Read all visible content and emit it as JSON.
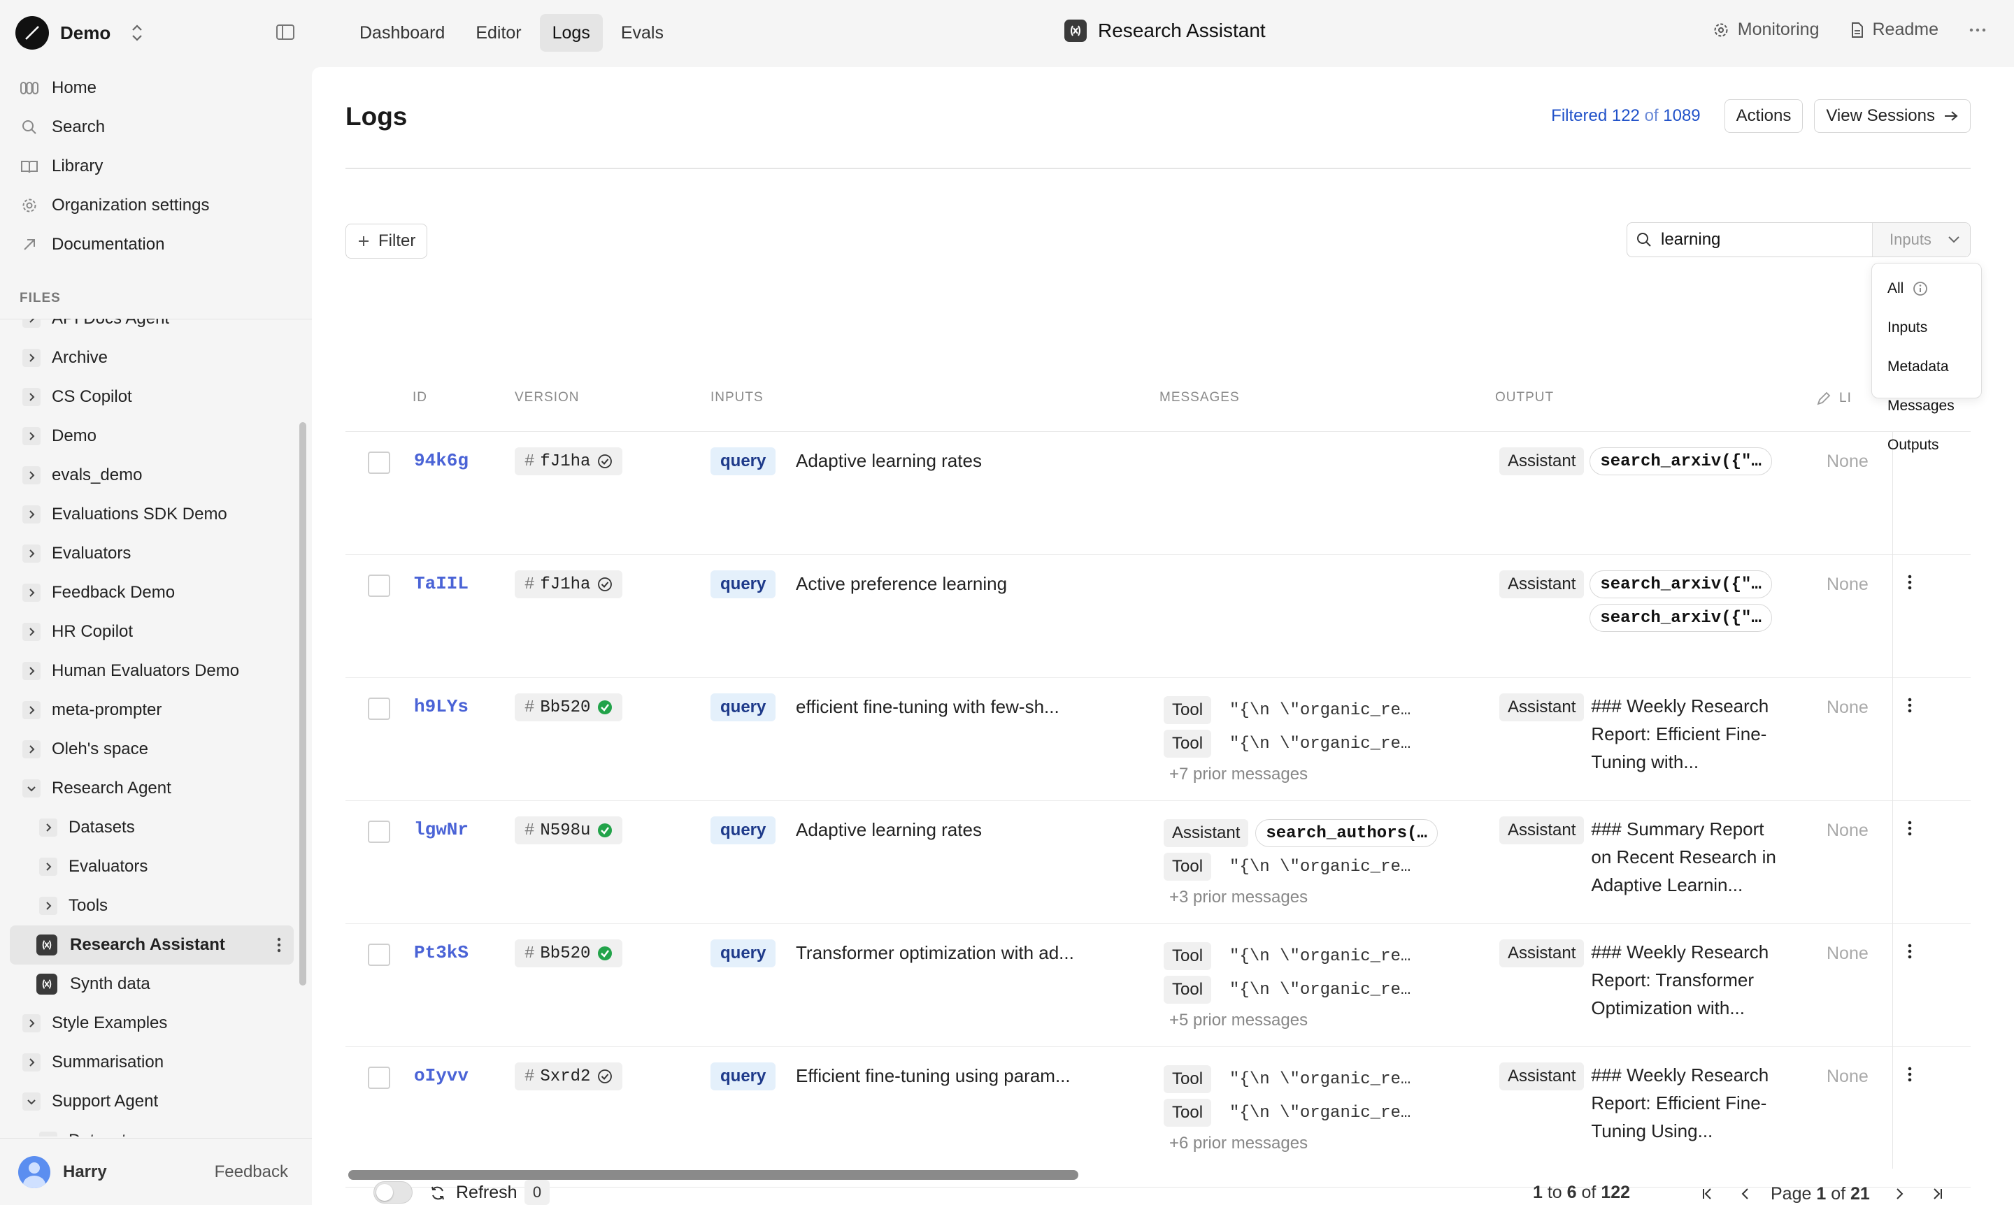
{
  "workspace": {
    "name": "Demo"
  },
  "nav": [
    {
      "label": "Home",
      "icon": "home-icon"
    },
    {
      "label": "Search",
      "icon": "search-icon"
    },
    {
      "label": "Library",
      "icon": "book-icon"
    },
    {
      "label": "Organization settings",
      "icon": "gear-icon"
    },
    {
      "label": "Documentation",
      "icon": "external-link-icon"
    }
  ],
  "files_label": "FILES",
  "tree": [
    {
      "label": "API Docs Agent",
      "type": "folder",
      "depth": 0,
      "expanded": false
    },
    {
      "label": "Archive",
      "type": "folder",
      "depth": 0,
      "expanded": false
    },
    {
      "label": "CS Copilot",
      "type": "folder",
      "depth": 0,
      "expanded": false
    },
    {
      "label": "Demo",
      "type": "folder",
      "depth": 0,
      "expanded": false
    },
    {
      "label": "evals_demo",
      "type": "folder",
      "depth": 0,
      "expanded": false
    },
    {
      "label": "Evaluations SDK Demo",
      "type": "folder",
      "depth": 0,
      "expanded": false
    },
    {
      "label": "Evaluators",
      "type": "folder",
      "depth": 0,
      "expanded": false
    },
    {
      "label": "Feedback Demo",
      "type": "folder",
      "depth": 0,
      "expanded": false
    },
    {
      "label": "HR Copilot",
      "type": "folder",
      "depth": 0,
      "expanded": false
    },
    {
      "label": "Human Evaluators Demo",
      "type": "folder",
      "depth": 0,
      "expanded": false
    },
    {
      "label": "meta-prompter",
      "type": "folder",
      "depth": 0,
      "expanded": false
    },
    {
      "label": "Oleh's space",
      "type": "folder",
      "depth": 0,
      "expanded": false
    },
    {
      "label": "Research Agent",
      "type": "folder",
      "depth": 0,
      "expanded": true
    },
    {
      "label": "Datasets",
      "type": "folder",
      "depth": 1,
      "expanded": false
    },
    {
      "label": "Evaluators",
      "type": "folder",
      "depth": 1,
      "expanded": false
    },
    {
      "label": "Tools",
      "type": "folder",
      "depth": 1,
      "expanded": false
    },
    {
      "label": "Research Assistant",
      "type": "prompt",
      "depth": 1,
      "active": true
    },
    {
      "label": "Synth data",
      "type": "prompt",
      "depth": 1
    },
    {
      "label": "Style Examples",
      "type": "folder",
      "depth": 0,
      "expanded": false
    },
    {
      "label": "Summarisation",
      "type": "folder",
      "depth": 0,
      "expanded": false
    },
    {
      "label": "Support Agent",
      "type": "folder",
      "depth": 0,
      "expanded": true
    },
    {
      "label": "Datasets",
      "type": "folder",
      "depth": 1,
      "expanded": false
    }
  ],
  "user": {
    "name": "Harry",
    "feedback": "Feedback"
  },
  "tabs": [
    {
      "label": "Dashboard",
      "active": false
    },
    {
      "label": "Editor",
      "active": false
    },
    {
      "label": "Logs",
      "active": true
    },
    {
      "label": "Evals",
      "active": false
    }
  ],
  "file_title": "Research Assistant",
  "top_right": {
    "monitoring": "Monitoring",
    "readme": "Readme"
  },
  "page": {
    "title": "Logs",
    "filtered_label": "Filtered",
    "filtered_count": "122",
    "of": "of",
    "total_count": "1089",
    "actions_label": "Actions",
    "view_sessions_label": "View Sessions",
    "filter_label": "Filter"
  },
  "search": {
    "value": "learning",
    "scope": "Inputs"
  },
  "scope_options": [
    "All",
    "Inputs",
    "Metadata",
    "Messages",
    "Outputs"
  ],
  "columns": {
    "id": "ID",
    "version": "VERSION",
    "inputs": "INPUTS",
    "messages": "MESSAGES",
    "output": "OUTPUT",
    "extra": "LI"
  },
  "rows": [
    {
      "id": "94k6g",
      "version": "fJ1ha",
      "deployed": false,
      "input_key": "query",
      "input_value": "Adaptive learning rates",
      "messages": [],
      "prior": "",
      "output_role": "Assistant",
      "output_calls": [
        "search_arxiv({\"…"
      ],
      "output_text": "",
      "extra": "None"
    },
    {
      "id": "TaIIL",
      "version": "fJ1ha",
      "deployed": false,
      "input_key": "query",
      "input_value": "Active preference learning",
      "messages": [],
      "prior": "",
      "output_role": "Assistant",
      "output_calls": [
        "search_arxiv({\"…",
        "search_arxiv({\"…"
      ],
      "output_text": "",
      "extra": "None"
    },
    {
      "id": "h9LYs",
      "version": "Bb520",
      "deployed": true,
      "input_key": "query",
      "input_value": "efficient fine-tuning with few-sh...",
      "messages": [
        {
          "role": "Tool",
          "content": "\"{\\n  \\\"organic_re…",
          "call": false
        },
        {
          "role": "Tool",
          "content": "\"{\\n  \\\"organic_re…",
          "call": false
        }
      ],
      "prior": "+7 prior messages",
      "output_role": "Assistant",
      "output_calls": [],
      "output_text": "### Weekly Research Report: Efficient Fine-Tuning with...",
      "extra": "None"
    },
    {
      "id": "lgwNr",
      "version": "N598u",
      "deployed": true,
      "input_key": "query",
      "input_value": "Adaptive learning rates",
      "messages": [
        {
          "role": "Assistant",
          "content": "search_authors(…",
          "call": true
        },
        {
          "role": "Tool",
          "content": "\"{\\n  \\\"organic_re…",
          "call": false
        }
      ],
      "prior": "+3 prior messages",
      "output_role": "Assistant",
      "output_calls": [],
      "output_text": "### Summary Report on Recent Research in Adaptive Learnin...",
      "extra": "None"
    },
    {
      "id": "Pt3kS",
      "version": "Bb520",
      "deployed": true,
      "input_key": "query",
      "input_value": "Transformer optimization with ad...",
      "messages": [
        {
          "role": "Tool",
          "content": "\"{\\n  \\\"organic_re…",
          "call": false
        },
        {
          "role": "Tool",
          "content": "\"{\\n  \\\"organic_re…",
          "call": false
        }
      ],
      "prior": "+5 prior messages",
      "output_role": "Assistant",
      "output_calls": [],
      "output_text": "### Weekly Research Report: Transformer Optimization with...",
      "extra": "None"
    },
    {
      "id": "oIyvv",
      "version": "Sxrd2",
      "deployed": false,
      "input_key": "query",
      "input_value": "Efficient fine-tuning using param...",
      "messages": [
        {
          "role": "Tool",
          "content": "\"{\\n  \\\"organic_re…",
          "call": false
        },
        {
          "role": "Tool",
          "content": "\"{\\n  \\\"organic_re…",
          "call": false
        }
      ],
      "prior": "+6 prior messages",
      "output_role": "Assistant",
      "output_calls": [],
      "output_text": "### Weekly Research Report: Efficient Fine-Tuning Using...",
      "extra": "None"
    }
  ],
  "footer": {
    "refresh_label": "Refresh",
    "refresh_count": "0",
    "range_from": "1",
    "range_to": "6",
    "range_total": "122",
    "to": "to",
    "of": "of",
    "page_label": "Page",
    "page_current": "1",
    "page_total": "21"
  },
  "colors": {
    "accent": "#2152c9",
    "id_link": "#4a63d6",
    "deployed_check": "#22a34a"
  }
}
